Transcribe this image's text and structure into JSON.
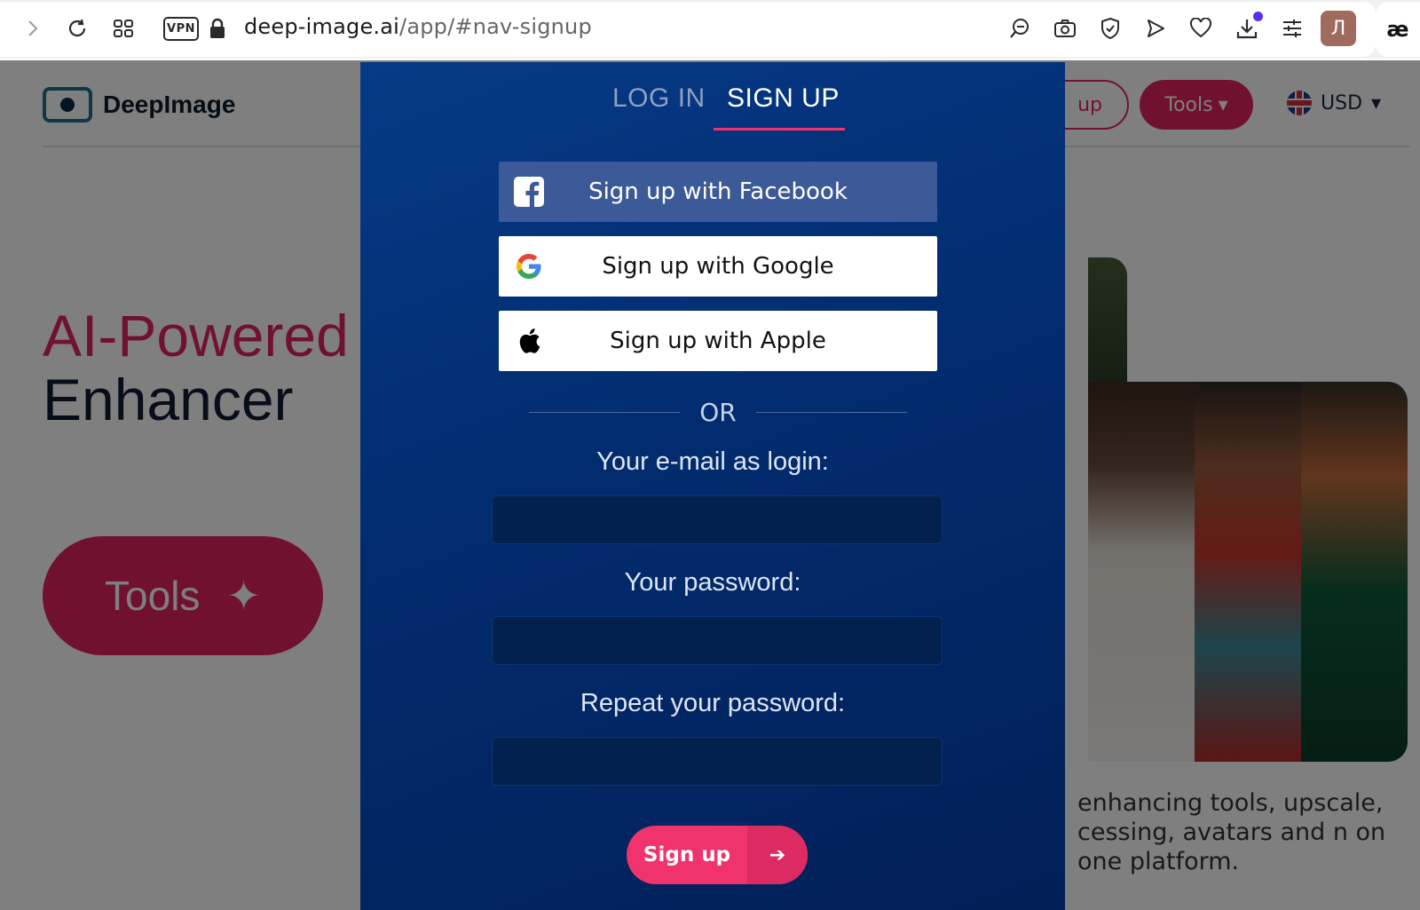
{
  "browser": {
    "url_host": "deep-image.ai",
    "url_path": "/app/#nav-signup",
    "vpn_label": "VPN",
    "avatar_letter": "Л",
    "extension_label": "æ"
  },
  "page": {
    "logo_text": "DeepImage",
    "hero_line1": "AI-Powered",
    "hero_line2": "Enhancer",
    "tools_button": "Tools",
    "nav_signup_partial": "up",
    "nav_tools": "Tools",
    "currency": "USD",
    "description_partial": "enhancing tools, upscale, cessing, avatars and n on one platform."
  },
  "modal": {
    "tab_login": "LOG IN",
    "tab_signup": "SIGN UP",
    "facebook_label": "Sign up with Facebook",
    "google_label": "Sign up with Google",
    "apple_label": "Sign up with Apple",
    "or_text": "OR",
    "email_label": "Your e-mail as login:",
    "password_label": "Your password:",
    "repeat_label": "Repeat your password:",
    "email_value": "",
    "password_value": "",
    "repeat_value": "",
    "submit_label": "Sign up"
  },
  "colors": {
    "accent": "#f0326d",
    "modal_bg": "#022c6f",
    "facebook": "#3d5a98"
  }
}
